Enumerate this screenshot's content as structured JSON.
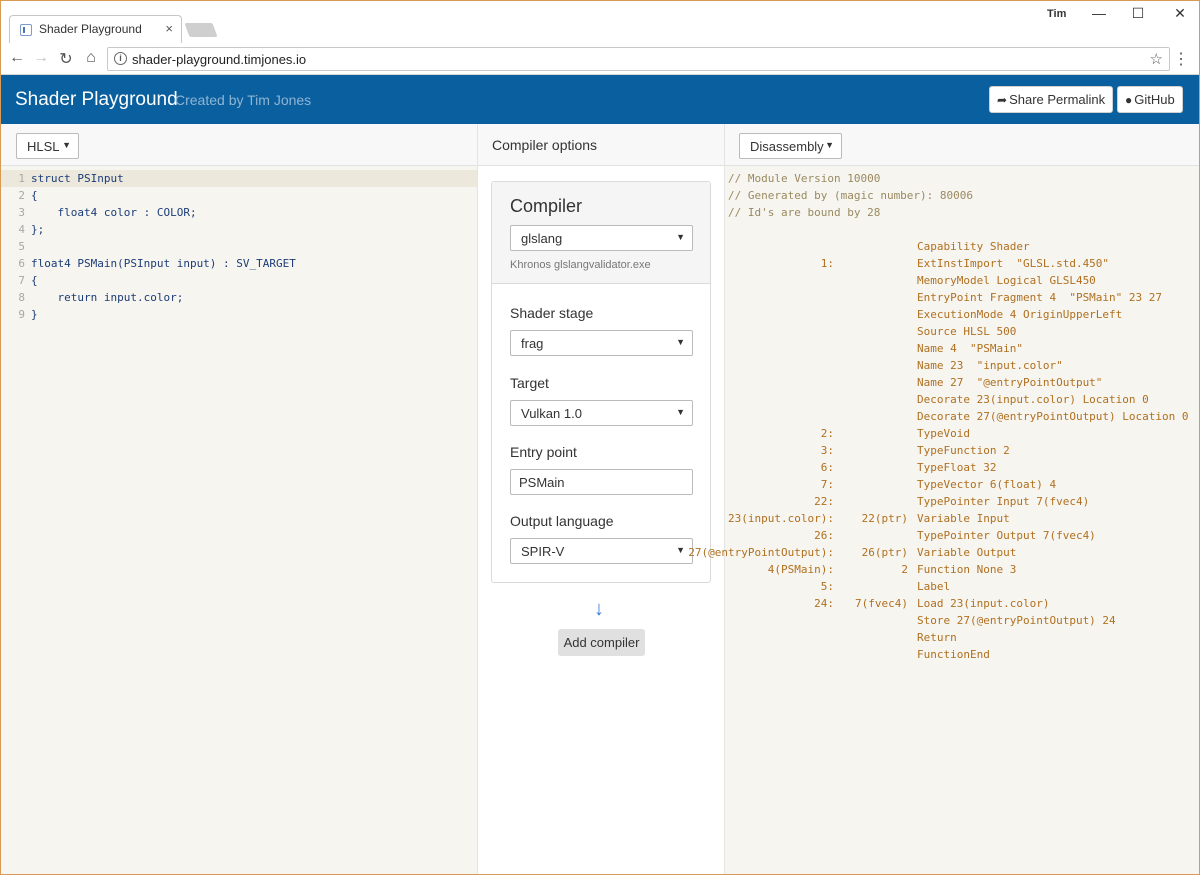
{
  "browser": {
    "tab_title": "Shader Playground",
    "tab_close": "×",
    "profile_name": "Tim",
    "win_minimize": "—",
    "win_maximize": "☐",
    "win_close": "✕",
    "nav_back": "←",
    "nav_forward": "→",
    "nav_reload": "↻",
    "nav_home": "⌂",
    "url_info": "i",
    "url": "shader-playground.timjones.io",
    "bookmark_star": "☆",
    "menu": "⋮"
  },
  "header": {
    "title": "Shader Playground",
    "subtitle": "Created by Tim Jones",
    "share_icon": "➦",
    "share_label": "Share Permalink",
    "github_icon": "●",
    "github_label": "GitHub"
  },
  "source": {
    "language": "HLSL",
    "caret": "▼",
    "lines": [
      {
        "n": "1",
        "text": "struct PSInput"
      },
      {
        "n": "2",
        "text": "{"
      },
      {
        "n": "3",
        "text": "    float4 color : COLOR;"
      },
      {
        "n": "4",
        "text": "};"
      },
      {
        "n": "5",
        "text": ""
      },
      {
        "n": "6",
        "text": "float4 PSMain(PSInput input) : SV_TARGET"
      },
      {
        "n": "7",
        "text": "{"
      },
      {
        "n": "8",
        "text": "    return input.color;"
      },
      {
        "n": "9",
        "text": "}"
      }
    ]
  },
  "compiler_options": {
    "title": "Compiler options",
    "card_title": "Compiler",
    "compiler": "glslang",
    "compiler_desc": "Khronos glslangvalidator.exe",
    "shader_stage_label": "Shader stage",
    "shader_stage": "frag",
    "target_label": "Target",
    "target": "Vulkan 1.0",
    "entry_point_label": "Entry point",
    "entry_point": "PSMain",
    "output_language_label": "Output language",
    "output_language": "SPIR-V",
    "arrow": "↓",
    "add_compiler_label": "Add compiler"
  },
  "output": {
    "view": "Disassembly",
    "comments": [
      "// Module Version 10000",
      "// Generated by (magic number): 80006",
      "// Id's are bound by 28"
    ],
    "instructions": [
      {
        "id": "",
        "type": "",
        "op": ""
      },
      {
        "id": "",
        "type": "",
        "op": "Capability Shader"
      },
      {
        "id": "1:",
        "type": "",
        "op": "ExtInstImport  \"GLSL.std.450\""
      },
      {
        "id": "",
        "type": "",
        "op": "MemoryModel Logical GLSL450"
      },
      {
        "id": "",
        "type": "",
        "op": "EntryPoint Fragment 4  \"PSMain\" 23 27"
      },
      {
        "id": "",
        "type": "",
        "op": "ExecutionMode 4 OriginUpperLeft"
      },
      {
        "id": "",
        "type": "",
        "op": "Source HLSL 500"
      },
      {
        "id": "",
        "type": "",
        "op": "Name 4  \"PSMain\""
      },
      {
        "id": "",
        "type": "",
        "op": "Name 23  \"input.color\""
      },
      {
        "id": "",
        "type": "",
        "op": "Name 27  \"@entryPointOutput\""
      },
      {
        "id": "",
        "type": "",
        "op": "Decorate 23(input.color) Location 0"
      },
      {
        "id": "",
        "type": "",
        "op": "Decorate 27(@entryPointOutput) Location 0"
      },
      {
        "id": "2:",
        "type": "",
        "op": "TypeVoid"
      },
      {
        "id": "3:",
        "type": "",
        "op": "TypeFunction 2"
      },
      {
        "id": "6:",
        "type": "",
        "op": "TypeFloat 32"
      },
      {
        "id": "7:",
        "type": "",
        "op": "TypeVector 6(float) 4"
      },
      {
        "id": "22:",
        "type": "",
        "op": "TypePointer Input 7(fvec4)"
      },
      {
        "id": "23(input.color):",
        "type": "22(ptr)",
        "op": "Variable Input"
      },
      {
        "id": "26:",
        "type": "",
        "op": "TypePointer Output 7(fvec4)"
      },
      {
        "id": "27(@entryPointOutput):",
        "type": "26(ptr)",
        "op": "Variable Output"
      },
      {
        "id": "4(PSMain):",
        "type": "2",
        "op": "Function None 3"
      },
      {
        "id": "5:",
        "type": "",
        "op": "Label"
      },
      {
        "id": "24:",
        "type": "7(fvec4)",
        "op": "Load 23(input.color)"
      },
      {
        "id": "",
        "type": "",
        "op": "Store 27(@entryPointOutput) 24"
      },
      {
        "id": "",
        "type": "",
        "op": "Return"
      },
      {
        "id": "",
        "type": "",
        "op": "FunctionEnd"
      }
    ]
  },
  "colors": {
    "header_bg": "#0a5f9e",
    "code_keyword": "#1c3c78",
    "code_punct": "#b07020",
    "asm_text": "#b07020"
  }
}
